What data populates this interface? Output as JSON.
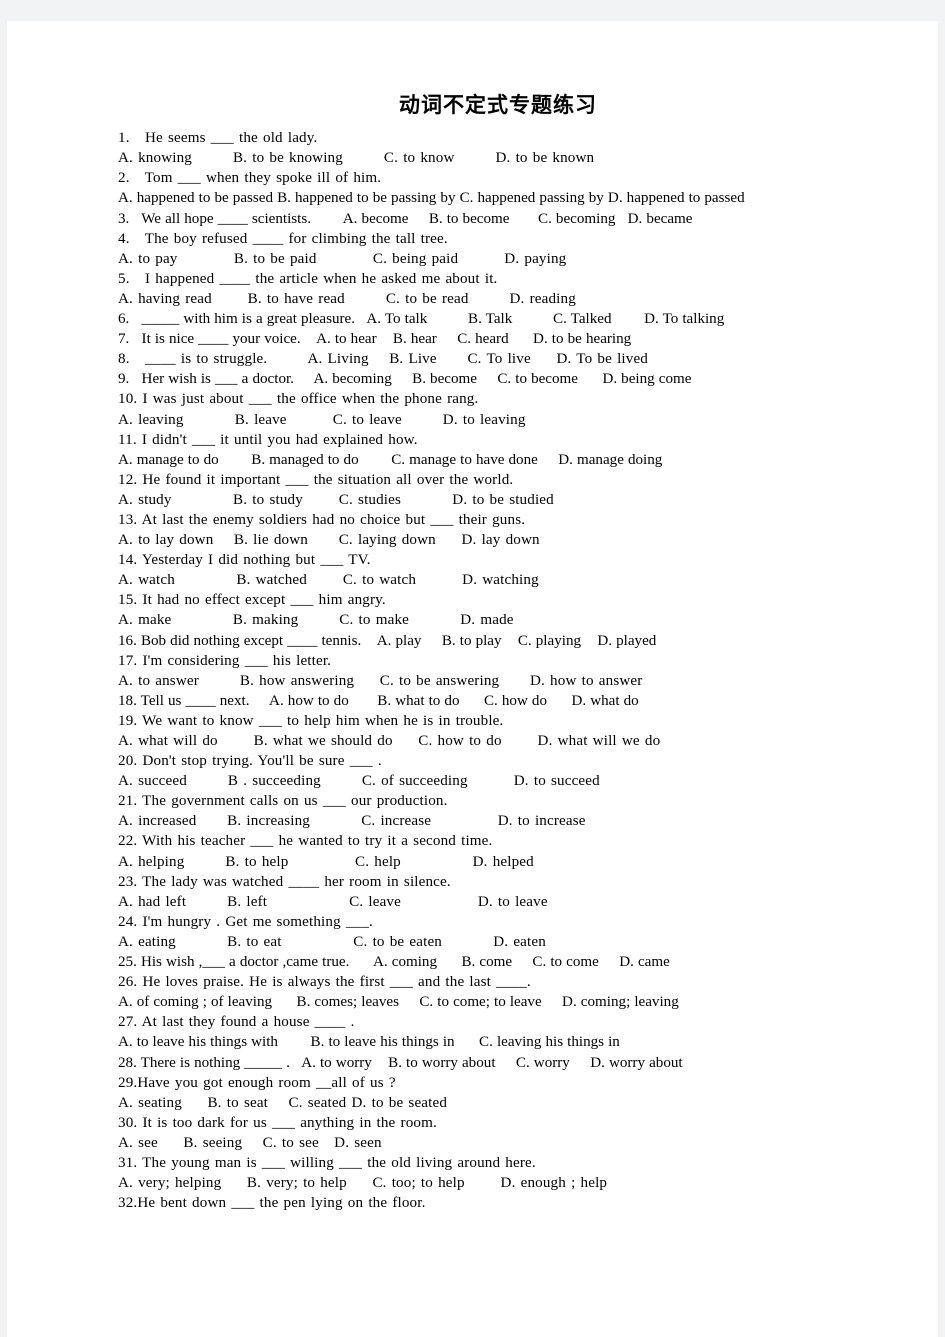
{
  "document": {
    "title": "动词不定式专题练习",
    "lines": [
      "1.   He seems ___ the old lady.",
      "A. knowing        B. to be knowing        C. to know        D. to be known",
      "2.   Tom ___ when they spoke ill of him.",
      "A. happened to be passed B. happened to be passing by C. happened passing by D. happened to passed",
      "3.   We all hope ____ scientists.        A. become     B. to become       C. becoming   D. became",
      "4.   The boy refused ____ for climbing the tall tree.",
      "A. to pay           B. to be paid           C. being paid         D. paying",
      "5.   I happened ____ the article when he asked me about it.",
      "A. having read       B. to have read        C. to be read        D. reading",
      "6.   _____ with him is a great pleasure.   A. To talk          B. Talk          C. Talked        D. To talking",
      "7.   It is nice ____ your voice.    A. to hear    B. hear     C. heard      D. to be hearing",
      "8.   ____ is to struggle.        A. Living    B. Live      C. To live     D. To be lived",
      "9.   Her wish is ___ a doctor.     A. becoming     B. become     C. to become      D. being come",
      "10. I was just about ___ the office when the phone rang.",
      "A. leaving          B. leave         C. to leave        D. to leaving",
      "11. I didn't ___ it until you had explained how.",
      "A. manage to do        B. managed to do        C. manage to have done     D. manage doing",
      "12. He found it important ___ the situation all over the world.",
      "A. study            B. to study       C. studies          D. to be studied",
      "13. At last the enemy soldiers had no choice but ___ their guns.",
      "A. to lay down    B. lie down      C. laying down     D. lay down",
      "14. Yesterday I did nothing but ___ TV.",
      "A. watch            B. watched       C. to watch         D. watching",
      "15. It had no effect except ___ him angry.",
      "A. make            B. making        C. to make          D. made",
      "16. Bob did nothing except ____ tennis.    A. play     B. to play    C. playing    D. played",
      "17. I'm considering ___ his letter.",
      "A. to answer        B. how answering     C. to be answering      D. how to answer",
      "18. Tell us ____ next.     A. how to do       B. what to do      C. how do      D. what do",
      "19. We want to know ___ to help him when he is in trouble.",
      "A. what will do       B. what we should do     C. how to do       D. what will we do",
      "20. Don't stop trying. You'll be sure ___ .",
      "A. succeed        B . succeeding        C. of succeeding         D. to succeed",
      "21. The government calls on us ___ our production.",
      "A. increased      B. increasing          C. increase             D. to increase",
      "22. With his teacher ___ he wanted to try it a second time.",
      "A. helping        B. to help             C. help              D. helped",
      "23. The lady was watched ____ her room in silence.",
      "A. had left        B. left                C. leave               D. to leave",
      "24. I'm hungry . Get me something ___.",
      "A. eating          B. to eat              C. to be eaten          D. eaten",
      "25. His wish ,___ a doctor ,came true.      A. coming      B. come     C. to come     D. came",
      "26. He loves praise. He is always the first ___ and the last ____.",
      "A. of coming ; of leaving      B. comes; leaves     C. to come; to leave     D. coming; leaving",
      "27. At last they found a house ____ .",
      "A. to leave his things with        B. to leave his things in      C. leaving his things in",
      "28. There is nothing _____ .   A. to worry    B. to worry about     C. worry     D. worry about",
      "29.Have you got enough room __all of us ?",
      "A. seating     B. to seat    C. seated D. to be seated",
      "30. It is too dark for us ___ anything in the room.",
      "A. see     B. seeing    C. to see   D. seen",
      "31. The young man is ___ willing ___ the old living around here.",
      "A. very; helping     B. very; to help     C. too; to help       D. enough ; help",
      "32.He bent down ___ the pen lying on the floor."
    ]
  }
}
